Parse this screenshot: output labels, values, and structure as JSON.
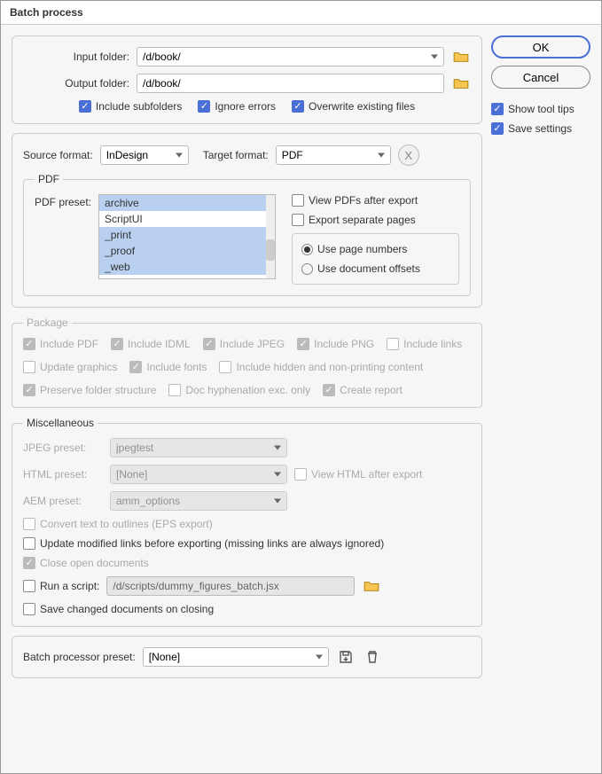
{
  "title": "Batch process",
  "folders": {
    "input_label": "Input folder:",
    "input_value": "/d/book/",
    "output_label": "Output folder:",
    "output_value": "/d/book/",
    "include_subfolders": "Include subfolders",
    "ignore_errors": "Ignore errors",
    "overwrite": "Overwrite existing files"
  },
  "format": {
    "source_label": "Source format:",
    "source_value": "InDesign",
    "target_label": "Target format:",
    "target_value": "PDF",
    "x_button": "X"
  },
  "pdf": {
    "legend": "PDF",
    "preset_label": "PDF preset:",
    "presets": [
      "archive",
      "ScriptUI",
      "_print",
      "_proof",
      "_web"
    ],
    "view_after": "View PDFs after export",
    "separate_pages": "Export separate pages",
    "use_page_numbers": "Use page numbers",
    "use_doc_offsets": "Use document offsets"
  },
  "package": {
    "legend": "Package",
    "include_pdf": "Include PDF",
    "include_idml": "Include IDML",
    "include_jpeg": "Include JPEG",
    "include_png": "Include PNG",
    "include_links": "Include links",
    "update_graphics": "Update graphics",
    "include_fonts": "Include fonts",
    "include_hidden": "Include hidden and non-printing content",
    "preserve_structure": "Preserve folder structure",
    "doc_hyphenation": "Doc hyphenation exc. only",
    "create_report": "Create report"
  },
  "misc": {
    "legend": "Miscellaneous",
    "jpeg_preset_label": "JPEG preset:",
    "jpeg_preset_value": "jpegtest",
    "html_preset_label": "HTML preset:",
    "html_preset_value": "[None]",
    "view_html": "View HTML after export",
    "aem_preset_label": "AEM preset:",
    "aem_preset_value": "amm_options",
    "convert_outlines": "Convert text to outlines (EPS export)",
    "update_links": "Update modified links before exporting (missing links are always ignored)",
    "close_docs": "Close open documents",
    "run_script": "Run a script:",
    "script_path": "/d/scripts/dummy_figures_batch.jsx",
    "save_changed": "Save changed documents on closing"
  },
  "batch_preset": {
    "label": "Batch processor preset:",
    "value": "[None]"
  },
  "buttons": {
    "ok": "OK",
    "cancel": "Cancel"
  },
  "side": {
    "tooltips": "Show tool tips",
    "save_settings": "Save settings"
  }
}
